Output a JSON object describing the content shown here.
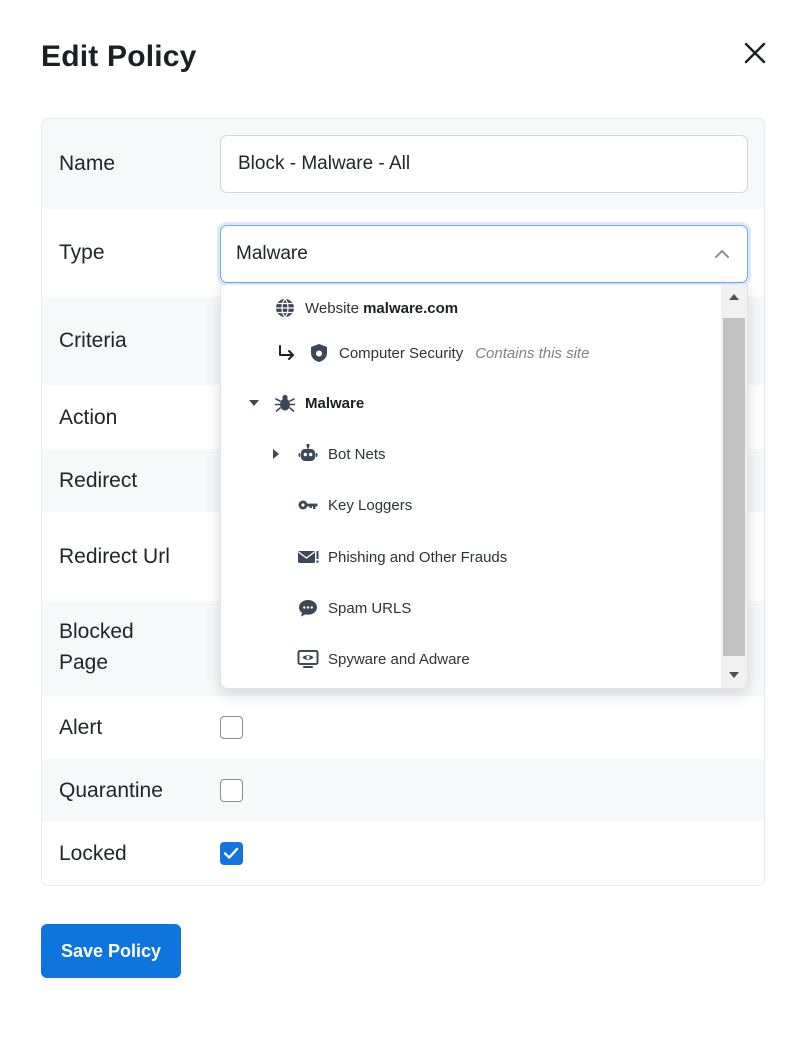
{
  "modal": {
    "title": "Edit Policy",
    "close_icon": "close-icon"
  },
  "form": {
    "name": {
      "label": "Name",
      "value": "Block - Malware - All"
    },
    "type": {
      "label": "Type",
      "value": "Malware"
    },
    "criteria": {
      "label": "Criteria"
    },
    "action": {
      "label": "Action"
    },
    "redirect": {
      "label": "Redirect"
    },
    "redirect_url": {
      "label": "Redirect Url"
    },
    "blocked_page": {
      "label": "Blocked Page"
    },
    "alert": {
      "label": "Alert",
      "checked": false
    },
    "quarantine": {
      "label": "Quarantine",
      "checked": false
    },
    "locked": {
      "label": "Locked",
      "checked": true
    }
  },
  "dropdown": {
    "website_prefix": "Website",
    "website_domain": "malware.com",
    "related": {
      "label": "Computer Security",
      "note": "Contains this site"
    },
    "group": {
      "label": "Malware",
      "icon": "bug-icon"
    },
    "items": [
      {
        "label": "Bot Nets",
        "icon": "robot-icon",
        "expandable": true
      },
      {
        "label": "Key Loggers",
        "icon": "key-icon",
        "expandable": false
      },
      {
        "label": "Phishing and Other Frauds",
        "icon": "envelope-alert-icon",
        "expandable": false
      },
      {
        "label": "Spam URLS",
        "icon": "chat-icon",
        "expandable": false
      },
      {
        "label": "Spyware and Adware",
        "icon": "monitor-eye-icon",
        "expandable": false
      }
    ]
  },
  "footer": {
    "save_label": "Save Policy"
  },
  "colors": {
    "primary": "#0f74de",
    "focus_border": "#6aaee8",
    "row_alt": "#f7f8fa"
  }
}
